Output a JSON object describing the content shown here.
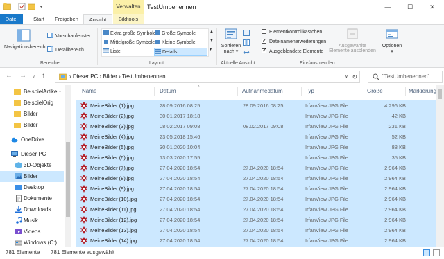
{
  "window": {
    "title": "TestUmbenennen",
    "contextual_tab": "Verwalten",
    "controls": [
      "—",
      "☐",
      "✕"
    ]
  },
  "ribbon_tabs": [
    {
      "label": "Datei"
    },
    {
      "label": "Start"
    },
    {
      "label": "Freigeben"
    },
    {
      "label": "Ansicht"
    },
    {
      "label": "Bildtools"
    }
  ],
  "ribbon": {
    "bereiche": {
      "group": "Bereiche",
      "nav_pane": "Navigationsbereich",
      "preview": "Vorschaufenster",
      "details": "Detailbereich"
    },
    "layout": {
      "group": "Layout",
      "items": [
        "Extra große Symbole",
        "Große Symbole",
        "Mittelgroße Symbole",
        "Kleine Symbole",
        "Liste",
        "Details"
      ],
      "selected": "Details"
    },
    "current_view": {
      "group": "Aktuelle Ansicht",
      "sort_line1": "Sortieren",
      "sort_line2": "nach ▾"
    },
    "show_hide": {
      "group": "Ein-/ausblenden",
      "checkboxes": [
        {
          "label": "Elementkontrollkästchen",
          "checked": false
        },
        {
          "label": "Dateinamenerweiterungen",
          "checked": true
        },
        {
          "label": "Ausgeblendete Elemente",
          "checked": true
        }
      ],
      "hide_selected_line1": "Ausgewählte",
      "hide_selected_line2": "Elemente ausblenden",
      "options": "Optionen",
      "options_arrow": "▾"
    }
  },
  "address": {
    "path": "›  Dieser PC  ›  Bilder  ›  TestUmbenennen",
    "dropdown": "∨",
    "refresh": "↻",
    "search_placeholder": "\"TestUmbenennen\" ..."
  },
  "nav_pane": {
    "items": [
      {
        "label": "BeispielArtike",
        "pin": "📌"
      },
      {
        "label": "BeispielOrig"
      },
      {
        "label": "Bilder"
      },
      {
        "label": "Bilder"
      },
      {
        "label": "OneDrive"
      },
      {
        "label": "Dieser PC"
      },
      {
        "label": "3D-Objekte"
      },
      {
        "label": "Bilder"
      },
      {
        "label": "Desktop"
      },
      {
        "label": "Dokumente"
      },
      {
        "label": "Downloads"
      },
      {
        "label": "Musik"
      },
      {
        "label": "Videos"
      },
      {
        "label": "Windows (C:)"
      }
    ]
  },
  "file_list": {
    "columns": [
      "Name",
      "Datum",
      "Aufnahmedatum",
      "Typ",
      "Größe",
      "Markierung"
    ],
    "rows": [
      {
        "name": "MeineBilder (1).jpg",
        "date": "28.09.2016 08:25",
        "taken": "28.09.2016 08:25",
        "type": "IrfanView JPG File",
        "size": "4.296 KB"
      },
      {
        "name": "MeineBilder (2).jpg",
        "date": "30.01.2017 18:18",
        "taken": "",
        "type": "IrfanView JPG File",
        "size": "42 KB"
      },
      {
        "name": "MeineBilder (3).jpg",
        "date": "08.02.2017 09:08",
        "taken": "08.02.2017 09:08",
        "type": "IrfanView JPG File",
        "size": "231 KB"
      },
      {
        "name": "MeineBilder (4).jpg",
        "date": "23.05.2018 15:46",
        "taken": "",
        "type": "IrfanView JPG File",
        "size": "52 KB"
      },
      {
        "name": "MeineBilder (5).jpg",
        "date": "30.01.2020 10:04",
        "taken": "",
        "type": "IrfanView JPG File",
        "size": "88 KB"
      },
      {
        "name": "MeineBilder (6).jpg",
        "date": "13.03.2020 17:55",
        "taken": "",
        "type": "IrfanView JPG File",
        "size": "35 KB"
      },
      {
        "name": "MeineBilder (7).jpg",
        "date": "27.04.2020 18:54",
        "taken": "27.04.2020 18:54",
        "type": "IrfanView JPG File",
        "size": "2.964 KB"
      },
      {
        "name": "MeineBilder (8).jpg",
        "date": "27.04.2020 18:54",
        "taken": "27.04.2020 18:54",
        "type": "IrfanView JPG File",
        "size": "2.964 KB"
      },
      {
        "name": "MeineBilder (9).jpg",
        "date": "27.04.2020 18:54",
        "taken": "27.04.2020 18:54",
        "type": "IrfanView JPG File",
        "size": "2.964 KB"
      },
      {
        "name": "MeineBilder (10).jpg",
        "date": "27.04.2020 18:54",
        "taken": "27.04.2020 18:54",
        "type": "IrfanView JPG File",
        "size": "2.964 KB"
      },
      {
        "name": "MeineBilder (11).jpg",
        "date": "27.04.2020 18:54",
        "taken": "27.04.2020 18:54",
        "type": "IrfanView JPG File",
        "size": "2.964 KB"
      },
      {
        "name": "MeineBilder (12).jpg",
        "date": "27.04.2020 18:54",
        "taken": "27.04.2020 18:54",
        "type": "IrfanView JPG File",
        "size": "2.964 KB"
      },
      {
        "name": "MeineBilder (13).jpg",
        "date": "27.04.2020 18:54",
        "taken": "27.04.2020 18:54",
        "type": "IrfanView JPG File",
        "size": "2.964 KB"
      },
      {
        "name": "MeineBilder (14).jpg",
        "date": "27.04.2020 18:54",
        "taken": "27.04.2020 18:54",
        "type": "IrfanView JPG File",
        "size": "2.964 KB"
      },
      {
        "name": "MeineBilder (15).jpg",
        "date": "27.04.2020 18:54",
        "taken": "27.04.2020 18:54",
        "type": "IrfanView JPG File",
        "size": "2.964 KB"
      }
    ]
  },
  "status": {
    "count": "781 Elemente",
    "selected": "781 Elemente ausgewählt"
  },
  "colors": {
    "accent": "#1979ca",
    "selection": "#cce8ff",
    "contextual": "#fbf0a8"
  }
}
